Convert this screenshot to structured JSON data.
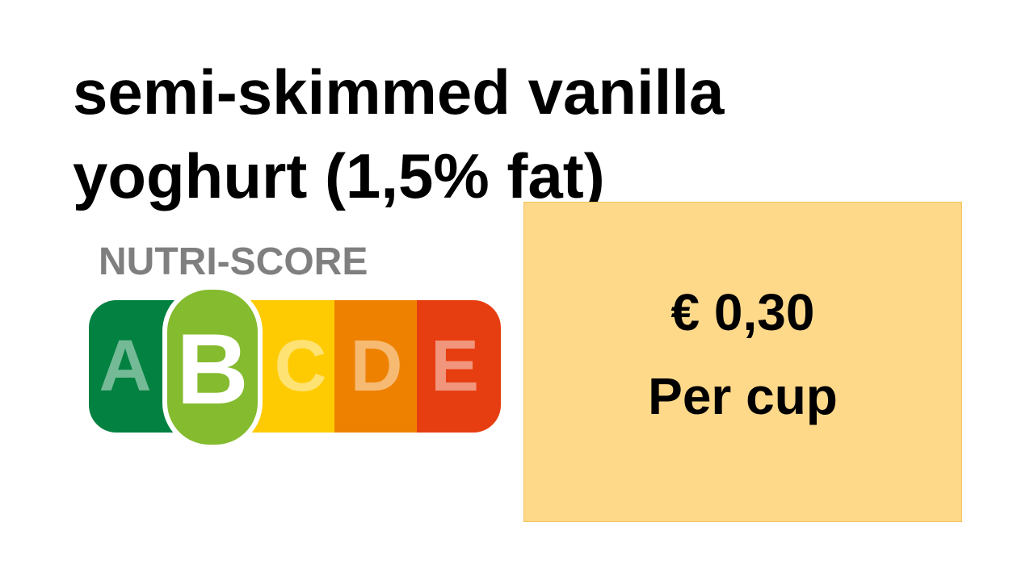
{
  "product": {
    "title_line1": "semi-skimmed vanilla",
    "title_line2": "yoghurt (1,5% fat)"
  },
  "nutri_score": {
    "label": "NUTRI-SCORE",
    "selected": "B",
    "grades": [
      {
        "letter": "A",
        "color": "#038141"
      },
      {
        "letter": "B",
        "color": "#85BB2F"
      },
      {
        "letter": "C",
        "color": "#FECB02"
      },
      {
        "letter": "D",
        "color": "#EE8100"
      },
      {
        "letter": "E",
        "color": "#E63E11"
      }
    ],
    "label_color": "#7F7F7F"
  },
  "price": {
    "amount": "€ 0,30",
    "unit": "Per cup",
    "box_color": "#FFD98A"
  }
}
